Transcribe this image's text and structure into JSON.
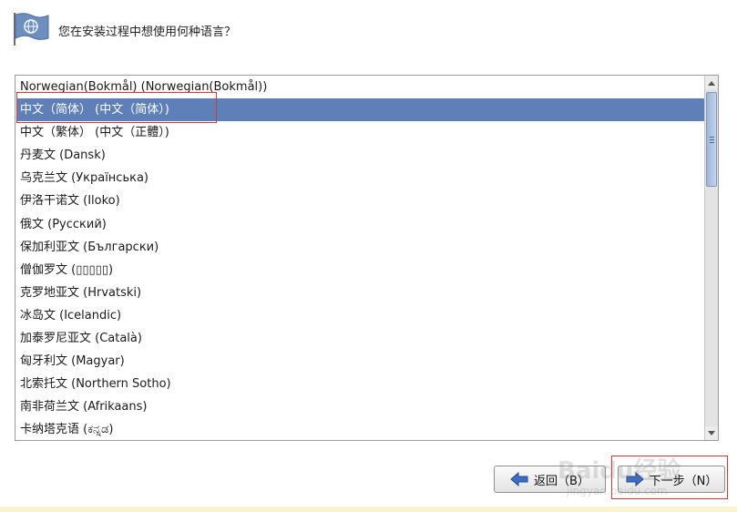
{
  "header": {
    "question": "您在安装过程中想使用何种语言？",
    "logo_icon": "flag-globe-icon"
  },
  "languages": {
    "items": [
      {
        "label": "Norwegian(Bokmål) (Norwegian(Bokmål))",
        "selected": false
      },
      {
        "label": "中文（简体） (中文（简体）)",
        "selected": true
      },
      {
        "label": "中文（繁体） (中文（正體）)",
        "selected": false
      },
      {
        "label": "丹麦文 (Dansk)",
        "selected": false
      },
      {
        "label": "乌克兰文 (Українська)",
        "selected": false
      },
      {
        "label": "伊洛干诺文 (Iloko)",
        "selected": false
      },
      {
        "label": "俄文 (Русский)",
        "selected": false
      },
      {
        "label": "保加利亚文 (Български)",
        "selected": false
      },
      {
        "label": "僧伽罗文 (▯▯▯▯▯)",
        "selected": false
      },
      {
        "label": "克罗地亚文 (Hrvatski)",
        "selected": false
      },
      {
        "label": "冰岛文 (Icelandic)",
        "selected": false
      },
      {
        "label": "加泰罗尼亚文 (Català)",
        "selected": false
      },
      {
        "label": "匈牙利文 (Magyar)",
        "selected": false
      },
      {
        "label": "北索托文 (Northern Sotho)",
        "selected": false
      },
      {
        "label": "南非荷兰文 (Afrikaans)",
        "selected": false
      },
      {
        "label": "卡纳塔克语 (ಕನ್ನಡ)",
        "selected": false
      }
    ]
  },
  "buttons": {
    "back_label": "返回（B）",
    "next_label": "下一步（N）"
  },
  "watermark": {
    "text": "Baidu经验",
    "sub": "jingyan.baidu.com"
  },
  "colors": {
    "selection": "#5f7fb8",
    "highlight_annotation": "#d23a3a",
    "arrow_blue": "#3a6fc4"
  }
}
